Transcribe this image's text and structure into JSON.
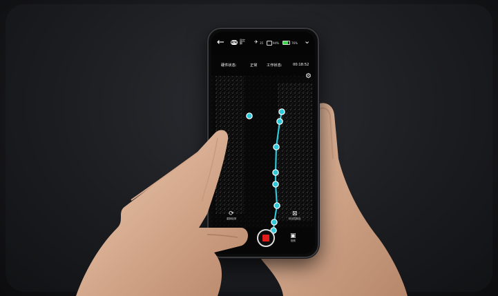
{
  "status": {
    "back_icon": "back-arrow-icon",
    "rtk_badge": "RTK",
    "rtk_label": "固定\n解",
    "satellites": "35",
    "battery_device": "94%",
    "battery_phone": "76%",
    "expand_icon": "double-chevron-down-icon"
  },
  "info": {
    "hardware_label": "硬件状态:",
    "hardware_value": "正常",
    "work_label": "工作状态:",
    "work_time": "00:18:52"
  },
  "controls": {
    "settings_icon": "gear-icon",
    "left_control": "重新检测",
    "right_control": "标记控制点",
    "right_bottom_control": "拍照",
    "record_icon": "stop-record-icon"
  },
  "colors": {
    "track": "#2ec8d8",
    "record": "#e21b1b",
    "battery": "#3fd14f"
  }
}
